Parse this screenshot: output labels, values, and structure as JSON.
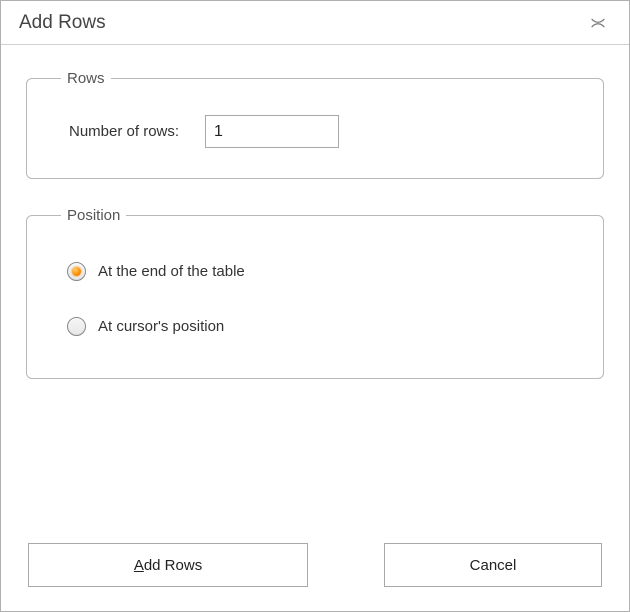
{
  "dialog": {
    "title": "Add Rows"
  },
  "rows_group": {
    "legend": "Rows",
    "number_label": "Number of rows:",
    "number_value": "1"
  },
  "position_group": {
    "legend": "Position",
    "option_end": "At the end of the table",
    "option_cursor": "At cursor's position",
    "selected": "end"
  },
  "buttons": {
    "add_prefix": "A",
    "add_rest": "dd Rows",
    "cancel": "Cancel"
  }
}
